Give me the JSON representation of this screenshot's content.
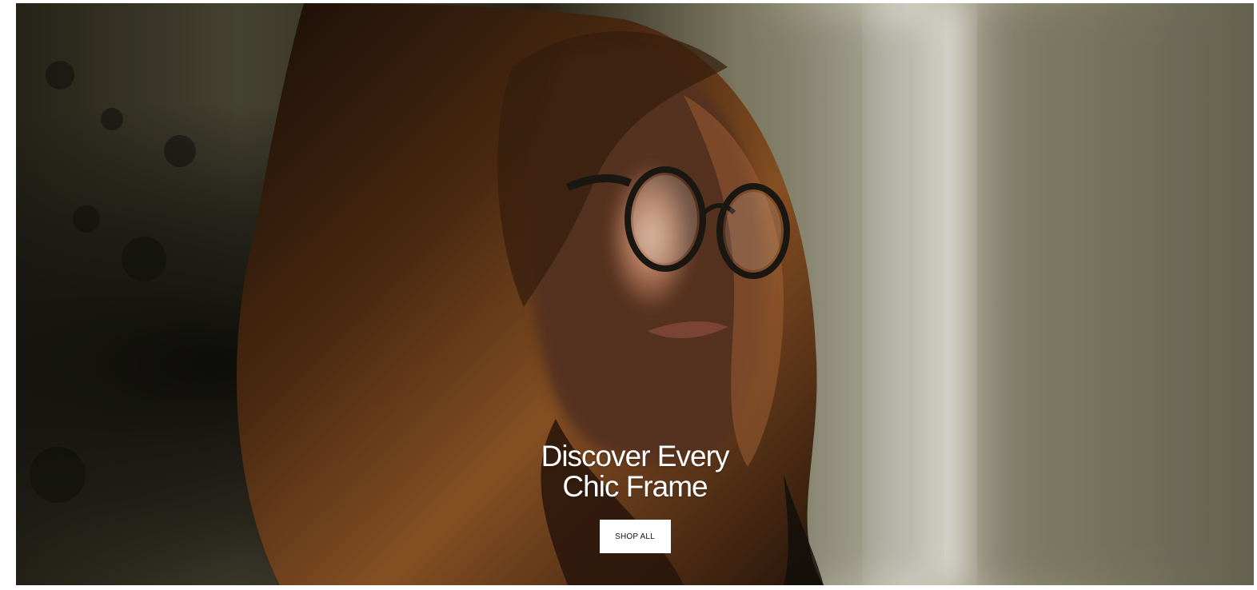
{
  "hero": {
    "image_icon": "woman-wearing-glasses-photo",
    "title_line_1": "Discover Every",
    "title_line_2": "Chic Frame",
    "button_label": "SHOP ALL"
  },
  "colors": {
    "title_text": "#ffffff",
    "button_background": "#ffffff",
    "button_text": "#111111"
  }
}
